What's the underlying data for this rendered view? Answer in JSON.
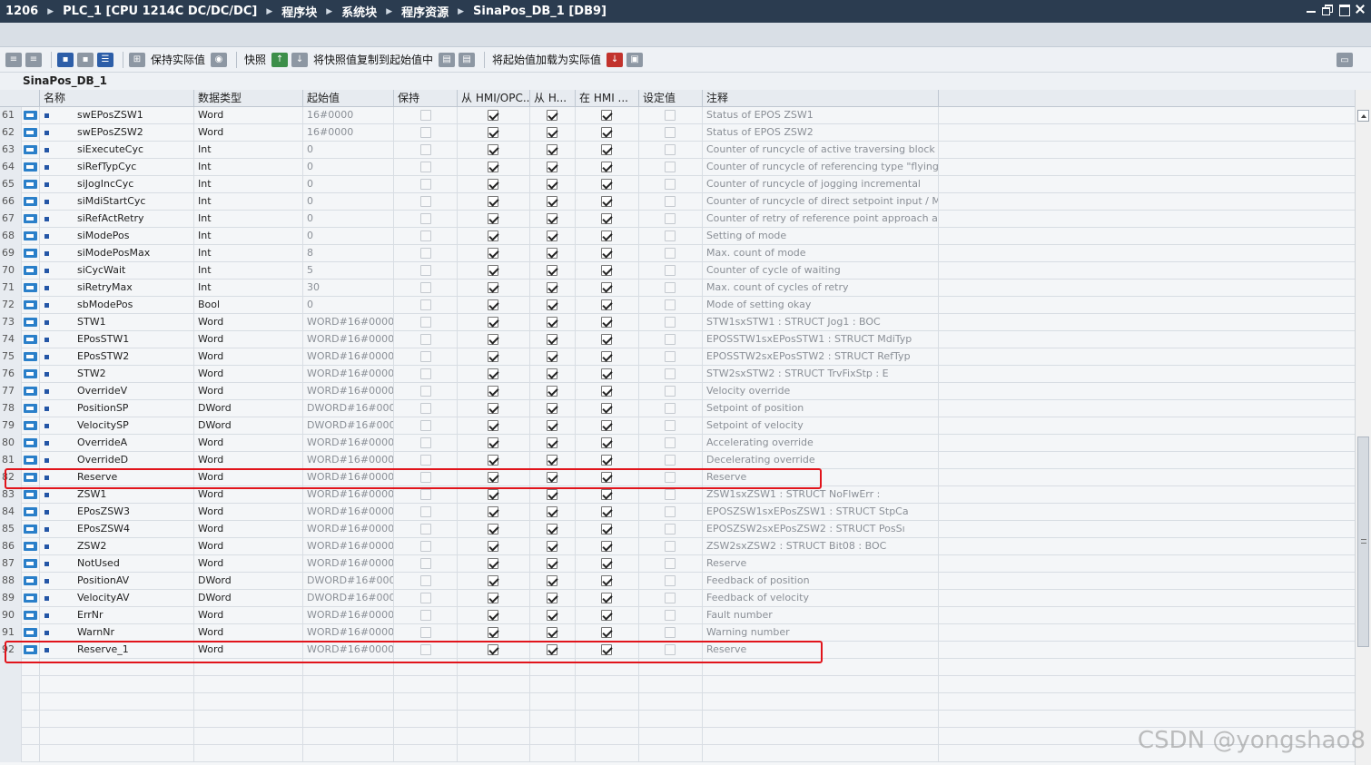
{
  "titlebar": {
    "crumbs": [
      "1206",
      "PLC_1 [CPU 1214C DC/DC/DC]",
      "程序块",
      "系统块",
      "程序资源",
      "SinaPos_DB_1 [DB9]"
    ],
    "separator": "▶"
  },
  "toolbar": {
    "keep_actual": "保持实际值",
    "snapshot": "快照",
    "copy_snapshot": "将快照值复制到起始值中",
    "load_start": "将起始值加载为实际值"
  },
  "db_name": "SinaPos_DB_1",
  "columns": {
    "name": "名称",
    "datatype": "数据类型",
    "start": "起始值",
    "retain": "保持",
    "hmi_opc": "从 HMI/OPC...",
    "hmi_h": "从 H...",
    "hmi_in": "在 HMI ...",
    "setpoint": "设定值",
    "comment": "注释"
  },
  "rows": [
    {
      "n": "61",
      "name": "swEPosZSW1",
      "type": "Word",
      "start": "16#0000",
      "comment": "Status of EPOS ZSW1"
    },
    {
      "n": "62",
      "name": "swEPosZSW2",
      "type": "Word",
      "start": "16#0000",
      "comment": "Status of EPOS ZSW2"
    },
    {
      "n": "63",
      "name": "siExecuteCyc",
      "type": "Int",
      "start": "0",
      "comment": "Counter of runcycle of active traversing block"
    },
    {
      "n": "64",
      "name": "siRefTypCyc",
      "type": "Int",
      "start": "0",
      "comment": "Counter of runcycle of referencing type \"flying re"
    },
    {
      "n": "65",
      "name": "siJogIncCyc",
      "type": "Int",
      "start": "0",
      "comment": "Counter of runcycle of jogging incremental"
    },
    {
      "n": "66",
      "name": "siMdiStartCyc",
      "type": "Int",
      "start": "0",
      "comment": "Counter of runcycle of direct setpoint input / MD"
    },
    {
      "n": "67",
      "name": "siRefActRetry",
      "type": "Int",
      "start": "0",
      "comment": "Counter of retry of reference point approach ac"
    },
    {
      "n": "68",
      "name": "siModePos",
      "type": "Int",
      "start": "0",
      "comment": "Setting of mode"
    },
    {
      "n": "69",
      "name": "siModePosMax",
      "type": "Int",
      "start": "8",
      "comment": "Max. count of mode"
    },
    {
      "n": "70",
      "name": "siCycWait",
      "type": "Int",
      "start": "5",
      "comment": "Counter of cycle of waiting"
    },
    {
      "n": "71",
      "name": "siRetryMax",
      "type": "Int",
      "start": "30",
      "comment": "Max. count of cycles of retry"
    },
    {
      "n": "72",
      "name": "sbModePos",
      "type": "Bool",
      "start": "0",
      "comment": "Mode of setting okay"
    },
    {
      "n": "73",
      "name": "STW1",
      "type": "Word",
      "start": "WORD#16#0000",
      "comment": "STW1sxSTW1     : STRUCT          Jog1           : BOC"
    },
    {
      "n": "74",
      "name": "EPosSTW1",
      "type": "Word",
      "start": "WORD#16#0000",
      "comment": "EPOSSTW1sxEPosSTW1   : STRUCT          MdiTyp"
    },
    {
      "n": "75",
      "name": "EPosSTW2",
      "type": "Word",
      "start": "WORD#16#0000",
      "comment": "EPOSSTW2sxEPosSTW2   : STRUCT          RefTyp"
    },
    {
      "n": "76",
      "name": "STW2",
      "type": "Word",
      "start": "WORD#16#0000",
      "comment": "STW2sxSTW2          : STRUCT        TrvFixStp      : E"
    },
    {
      "n": "77",
      "name": "OverrideV",
      "type": "Word",
      "start": "WORD#16#0000",
      "comment": "Velocity override"
    },
    {
      "n": "78",
      "name": "PositionSP",
      "type": "DWord",
      "start": "DWORD#16#0000",
      "comment": "Setpoint of position"
    },
    {
      "n": "79",
      "name": "VelocitySP",
      "type": "DWord",
      "start": "DWORD#16#0000",
      "comment": "Setpoint of velocity"
    },
    {
      "n": "80",
      "name": "OverrideA",
      "type": "Word",
      "start": "WORD#16#0000",
      "comment": "Accelerating override"
    },
    {
      "n": "81",
      "name": "OverrideD",
      "type": "Word",
      "start": "WORD#16#0000",
      "comment": "Decelerating override"
    },
    {
      "n": "82",
      "name": "Reserve",
      "type": "Word",
      "start": "WORD#16#0000",
      "comment": "Reserve"
    },
    {
      "n": "83",
      "name": "ZSW1",
      "type": "Word",
      "start": "WORD#16#0000",
      "comment": "ZSW1sxZSW1          : STRUCT         NoFlwErr        :"
    },
    {
      "n": "84",
      "name": "EPosZSW3",
      "type": "Word",
      "start": "WORD#16#0000",
      "comment": "EPOSZSW1sxEPosZSW1     : STRUCT         StpCa"
    },
    {
      "n": "85",
      "name": "EPosZSW4",
      "type": "Word",
      "start": "WORD#16#0000",
      "comment": "EPOSZSW2sxEPosZSW2     : STRUCT         PosSı"
    },
    {
      "n": "86",
      "name": "ZSW2",
      "type": "Word",
      "start": "WORD#16#0000",
      "comment": "ZSW2sxZSW2     : STRUCT          Bit08          : BOC"
    },
    {
      "n": "87",
      "name": "NotUsed",
      "type": "Word",
      "start": "WORD#16#0000",
      "comment": "Reserve"
    },
    {
      "n": "88",
      "name": "PositionAV",
      "type": "DWord",
      "start": "DWORD#16#0000",
      "comment": "Feedback of position"
    },
    {
      "n": "89",
      "name": "VelocityAV",
      "type": "DWord",
      "start": "DWORD#16#0000",
      "comment": "Feedback of velocity"
    },
    {
      "n": "90",
      "name": "ErrNr",
      "type": "Word",
      "start": "WORD#16#0000",
      "comment": "Fault number"
    },
    {
      "n": "91",
      "name": "WarnNr",
      "type": "Word",
      "start": "WORD#16#0000",
      "comment": "Warning number"
    },
    {
      "n": "92",
      "name": "Reserve_1",
      "type": "Word",
      "start": "WORD#16#0000",
      "comment": "Reserve"
    }
  ],
  "highlighted_rows": [
    "82",
    "92"
  ],
  "watermark": "CSDN @yongshao8",
  "colors": {
    "titlebar_bg": "#2b3c50",
    "highlight": "#e1141b",
    "interface_icon": "#2a7fc9"
  }
}
